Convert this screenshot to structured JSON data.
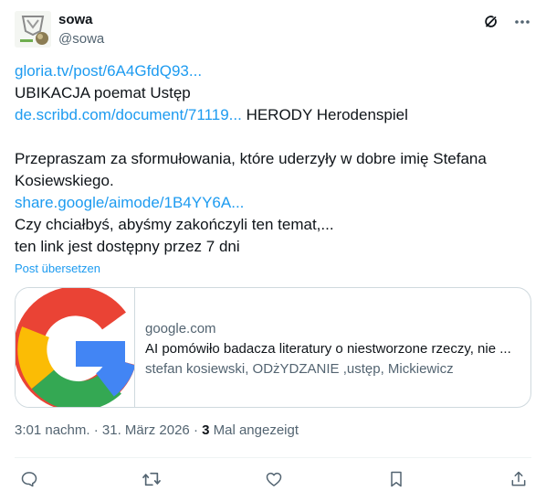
{
  "author": {
    "display_name": "sowa",
    "handle": "@sowa"
  },
  "icons": {
    "header": [
      "grok-icon",
      "more-icon"
    ],
    "actions": [
      "reply-icon",
      "repost-icon",
      "like-icon",
      "bookmark-icon",
      "share-icon"
    ]
  },
  "post": {
    "line1_link": "gloria.tv/post/6A4GfdQ93...",
    "line2": "UBIKACJA poemat Ustęp",
    "line3_link": "de.scribd.com/document/71119...",
    "line3_text": " HERODY Herodenspiel",
    "line4": "Przepraszam za sformułowania, które uderzyły w dobre imię Stefana",
    "line5": "Kosiewskiego.",
    "line6_link": "share.google/aimode/1B4YY6A...",
    "line7": "Czy chciałbyś, abyśmy zakończyli ten temat,...",
    "line8": "ten link jest dostępny przez 7 dni"
  },
  "translate_label": "Post übersetzen",
  "card": {
    "domain": "google.com",
    "title": "AI pomówiło badacza literatury o niestworzone rzeczy, nie ...",
    "description": "stefan kosiewski, ODżYDZANIE ,ustęp, Mickiewicz"
  },
  "meta": {
    "time_date": "3:01 nachm. · 31. März 2026 · ",
    "views_count": "3",
    "views_label": " Mal angezeigt"
  },
  "colors": {
    "link": "#1d9bf0",
    "secondary_text": "#536471",
    "border": "#cfd9de"
  }
}
